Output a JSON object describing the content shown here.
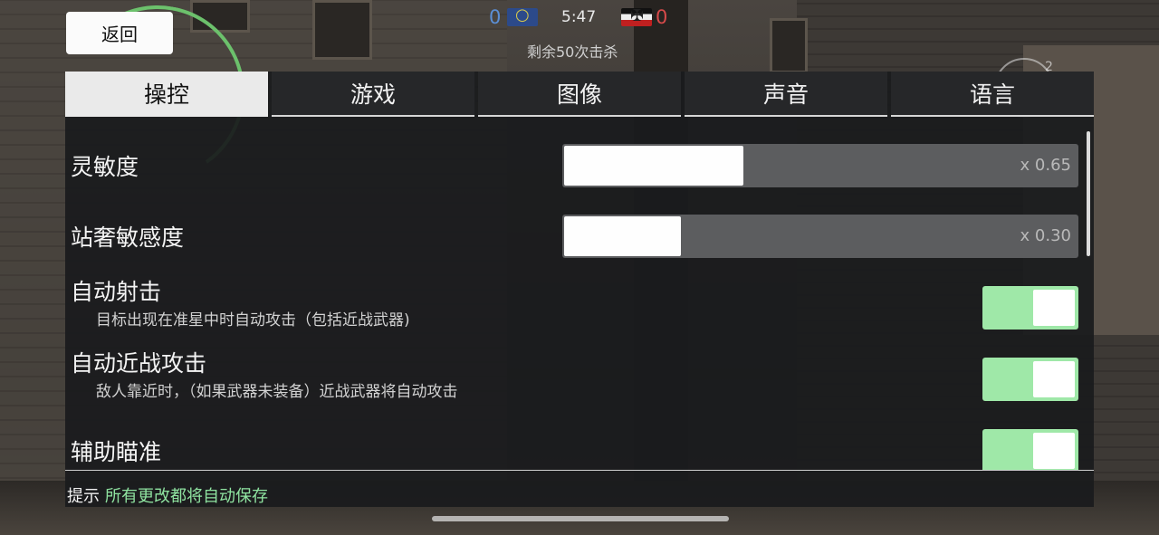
{
  "hud": {
    "score_left": "0",
    "score_right": "0",
    "timer": "5:47",
    "remaining": "剩余50次击杀",
    "crosshair_num_top": "2",
    "crosshair_num_left": "2"
  },
  "back_label": "返回",
  "tabs": [
    {
      "label": "操控",
      "active": true
    },
    {
      "label": "游戏",
      "active": false
    },
    {
      "label": "图像",
      "active": false
    },
    {
      "label": "声音",
      "active": false
    },
    {
      "label": "语言",
      "active": false
    }
  ],
  "settings": {
    "sensitivity": {
      "label": "灵敏度",
      "value_text": "x 0.65",
      "fraction": 0.35
    },
    "aim_sensitivity": {
      "label": "站奢敏感度",
      "value_text": "x 0.30",
      "fraction": 0.23
    },
    "auto_fire": {
      "label": "自动射击",
      "description": "目标出现在准星中时自动攻击（包括近战武器)",
      "enabled": true
    },
    "auto_melee": {
      "label": "自动近战攻击",
      "description": "敌人靠近时，（如果武器未装备）近战武器将自动攻击",
      "enabled": true
    },
    "aim_assist": {
      "label": "辅助瞄准",
      "enabled": true
    }
  },
  "hint": {
    "prefix": "提示",
    "message": "所有更改都将自动保存"
  },
  "colors": {
    "toggle_on": "#9fe8a8",
    "hint_text": "#8fe3a0",
    "score_left": "#5b8fd6",
    "score_right": "#d84a4a"
  }
}
